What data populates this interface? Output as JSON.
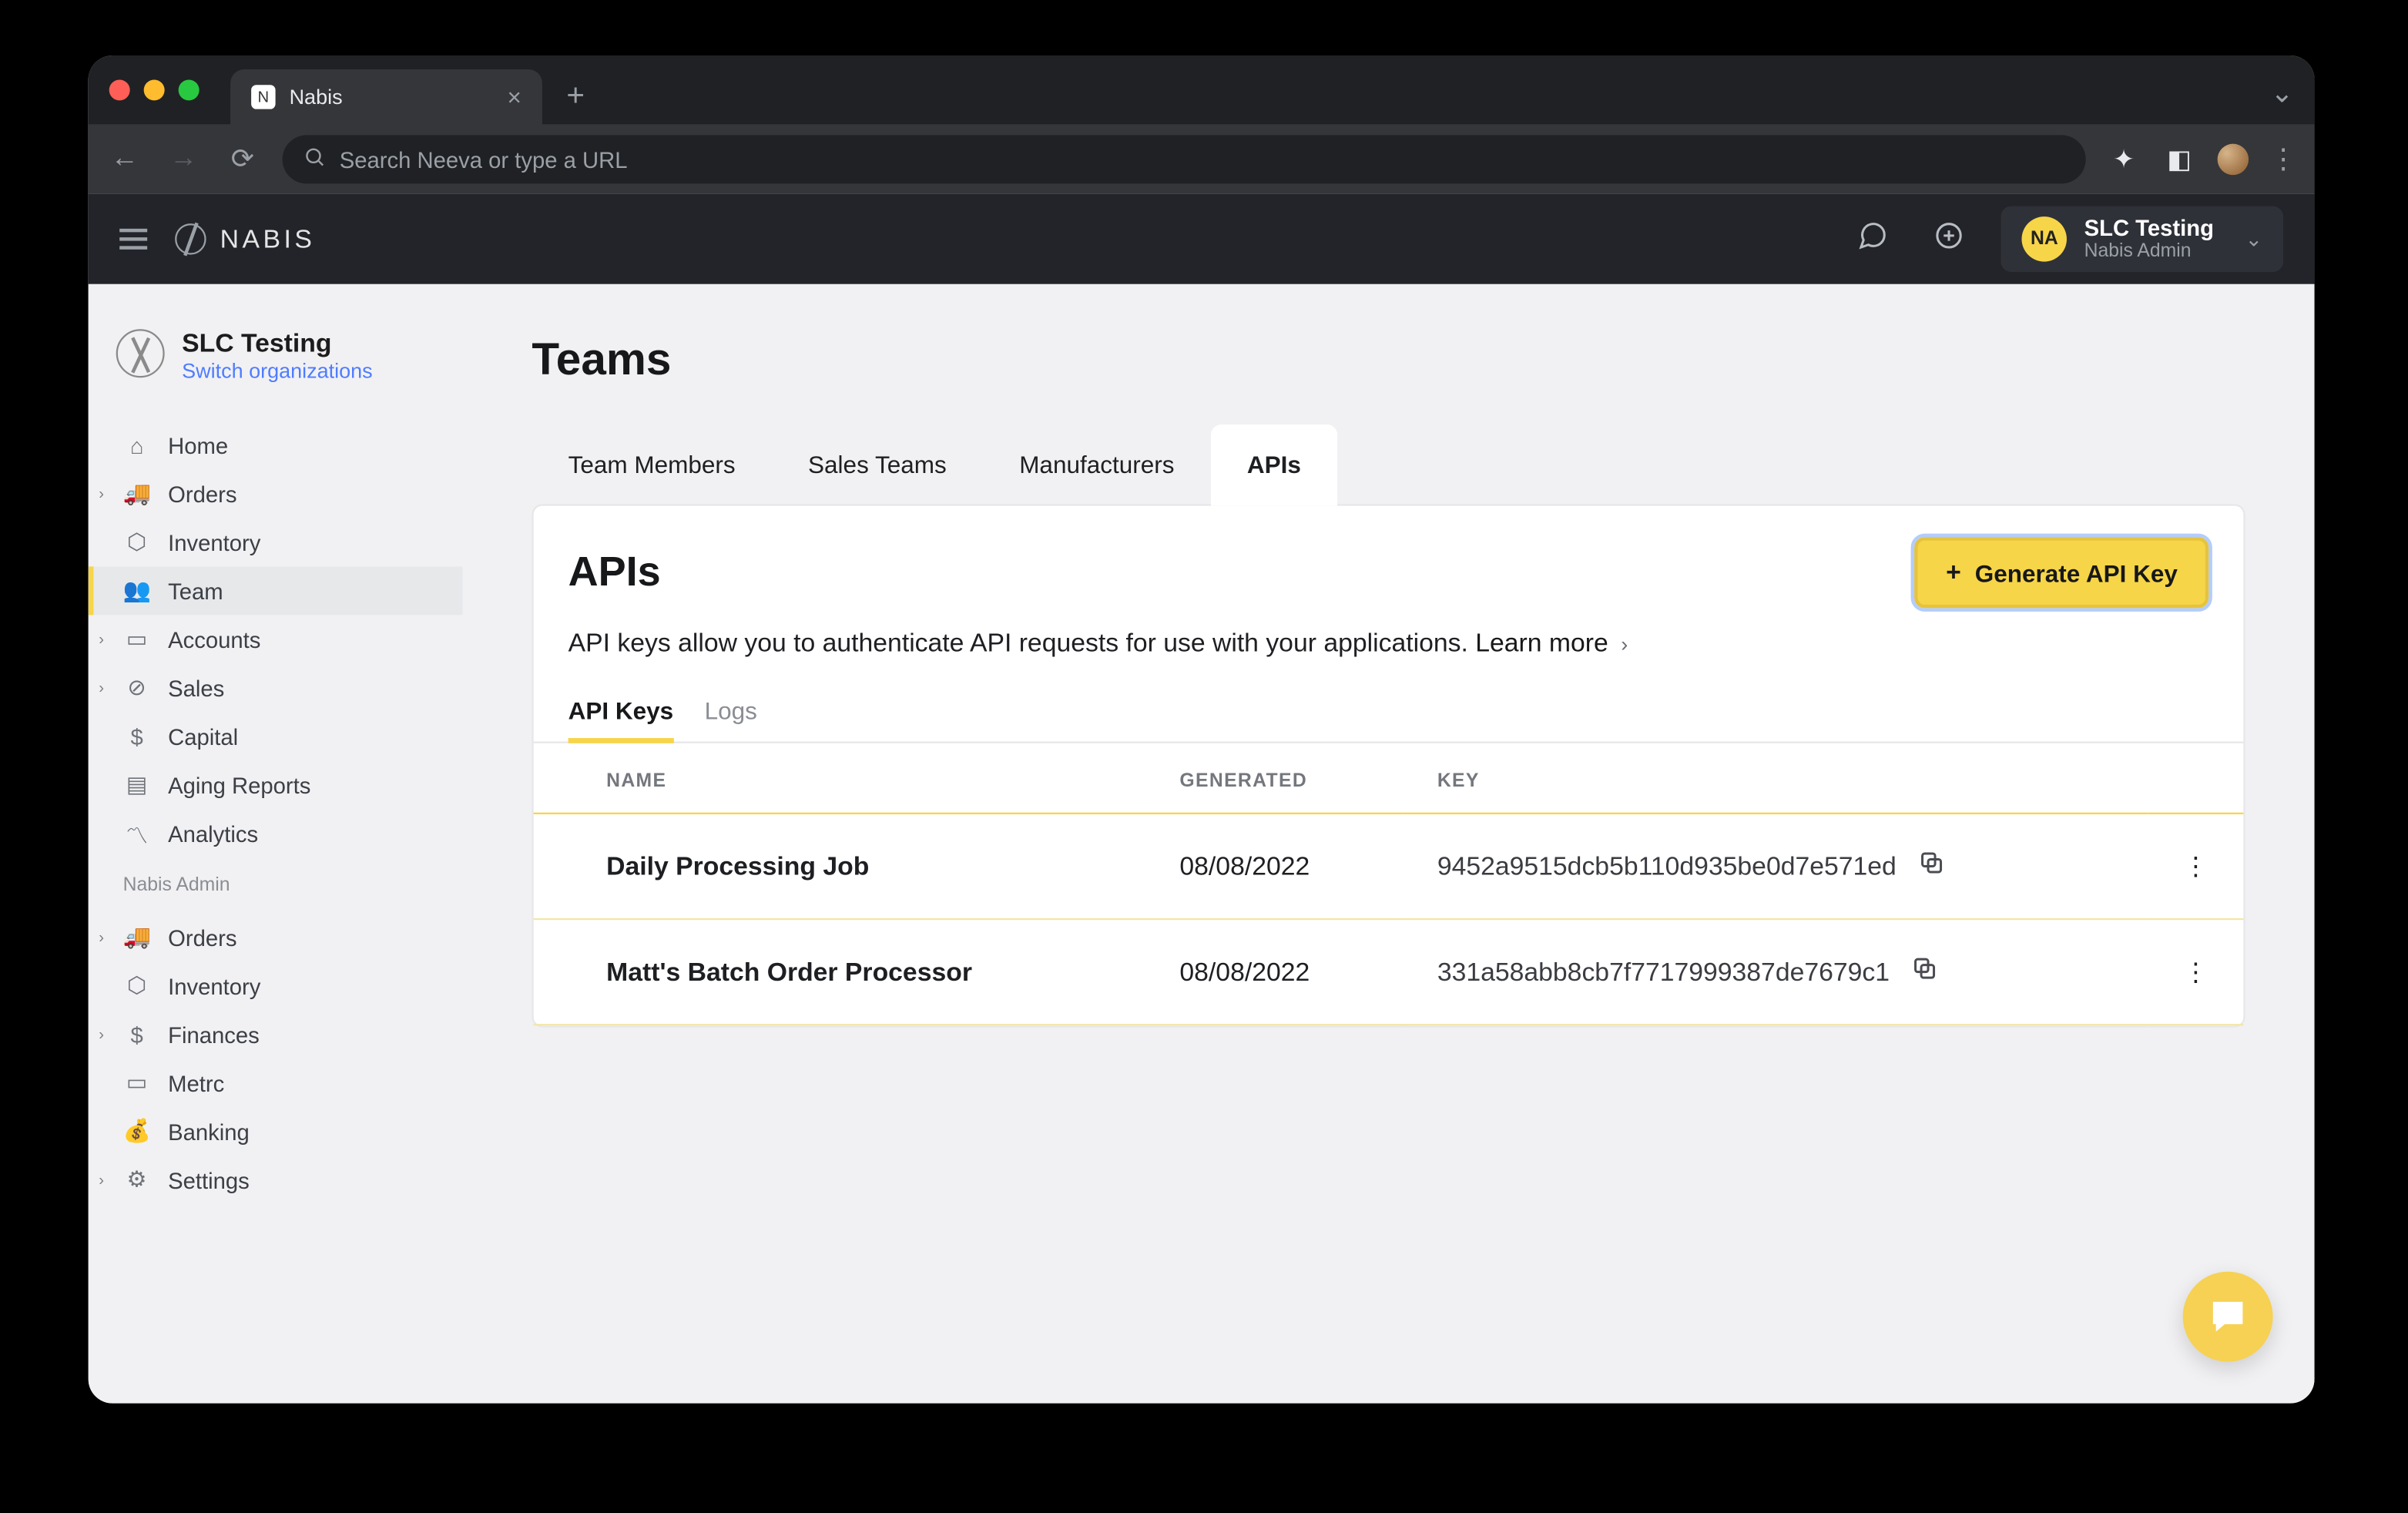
{
  "browser": {
    "tab_title": "Nabis",
    "omnibox_placeholder": "Search Neeva or type a URL"
  },
  "header": {
    "brand": "NABIS",
    "account": {
      "badge": "NA",
      "name": "SLC Testing",
      "role": "Nabis Admin"
    }
  },
  "sidebar": {
    "org_name": "SLC Testing",
    "switch_label": "Switch organizations",
    "group1": [
      {
        "label": "Home",
        "icon": "⌂",
        "caret": false
      },
      {
        "label": "Orders",
        "icon": "🚚",
        "caret": true
      },
      {
        "label": "Inventory",
        "icon": "⬡",
        "caret": false
      },
      {
        "label": "Team",
        "icon": "👥",
        "caret": false,
        "active": true
      },
      {
        "label": "Accounts",
        "icon": "▭",
        "caret": true
      },
      {
        "label": "Sales",
        "icon": "⊘",
        "caret": true
      },
      {
        "label": "Capital",
        "icon": "$",
        "caret": false
      },
      {
        "label": "Aging Reports",
        "icon": "▤",
        "caret": false
      },
      {
        "label": "Analytics",
        "icon": "〽",
        "caret": false
      }
    ],
    "section_label": "Nabis Admin",
    "group2": [
      {
        "label": "Orders",
        "icon": "🚚",
        "caret": true
      },
      {
        "label": "Inventory",
        "icon": "⬡",
        "caret": false
      },
      {
        "label": "Finances",
        "icon": "$",
        "caret": true
      },
      {
        "label": "Metrc",
        "icon": "▭",
        "caret": false
      },
      {
        "label": "Banking",
        "icon": "💰",
        "caret": false
      },
      {
        "label": "Settings",
        "icon": "⚙",
        "caret": true
      }
    ]
  },
  "page": {
    "title": "Teams",
    "tabs": [
      {
        "label": "Team Members"
      },
      {
        "label": "Sales Teams"
      },
      {
        "label": "Manufacturers"
      },
      {
        "label": "APIs",
        "active": true
      }
    ],
    "panel": {
      "title": "APIs",
      "generate_label": "Generate API Key",
      "description": "API keys allow you to authenticate API requests for use with your applications.",
      "learn_more": "Learn more",
      "subtabs": [
        {
          "label": "API Keys",
          "active": true
        },
        {
          "label": "Logs"
        }
      ],
      "columns": {
        "name": "NAME",
        "generated": "GENERATED",
        "key": "KEY"
      },
      "rows": [
        {
          "name": "Daily Processing Job",
          "generated": "08/08/2022",
          "key": "9452a9515dcb5b110d935be0d7e571ed"
        },
        {
          "name": "Matt's Batch Order Processor",
          "generated": "08/08/2022",
          "key": "331a58abb8cb7f7717999387de7679c1"
        }
      ]
    }
  }
}
